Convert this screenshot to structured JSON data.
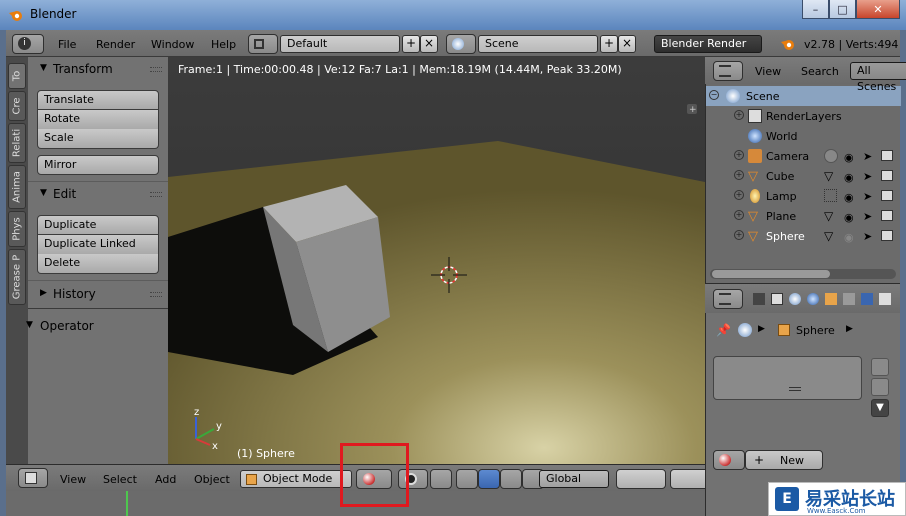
{
  "window": {
    "title": "Blender",
    "buttons": {
      "minimize": "–",
      "maximize": "□",
      "close": "✕"
    }
  },
  "info_header": {
    "menus": [
      "File",
      "Render",
      "Window",
      "Help"
    ],
    "screen_layout": "Default",
    "scene": "Scene",
    "render_engine": "Blender Render",
    "version_stats": "v2.78 | Verts:494"
  },
  "tool_tabs": [
    "To",
    "Cre",
    "Relati",
    "Anima",
    "Phys",
    "Grease P"
  ],
  "tool_shelf": {
    "transform": {
      "title": "Transform",
      "buttons": [
        "Translate",
        "Rotate",
        "Scale"
      ],
      "mirror": "Mirror"
    },
    "edit": {
      "title": "Edit",
      "buttons": [
        "Duplicate",
        "Duplicate Linked",
        "Delete"
      ]
    },
    "history": {
      "title": "History"
    },
    "operator": {
      "title": "Operator"
    }
  },
  "viewport": {
    "info": "Frame:1 | Time:00:00.48 | Ve:12 Fa:7 La:1 | Mem:18.19M (14.44M, Peak 33.20M)",
    "active_object": "(1) Sphere",
    "axis": {
      "x": "x",
      "y": "y",
      "z": "z"
    }
  },
  "view_header": {
    "menus": [
      "View",
      "Select",
      "Add",
      "Object"
    ],
    "mode": "Object Mode",
    "orientation": "Global"
  },
  "outliner": {
    "header": {
      "view": "View",
      "search": "Search",
      "filter": "All Scenes"
    },
    "items": [
      {
        "name": "Scene",
        "icon": "scene-icon",
        "indent": 0
      },
      {
        "name": "RenderLayers",
        "icon": "render-layers-icon",
        "indent": 1
      },
      {
        "name": "World",
        "icon": "world-icon",
        "indent": 1
      },
      {
        "name": "Camera",
        "icon": "camera-icon",
        "indent": 1
      },
      {
        "name": "Cube",
        "icon": "mesh-icon",
        "indent": 1
      },
      {
        "name": "Lamp",
        "icon": "lamp-icon",
        "indent": 1
      },
      {
        "name": "Plane",
        "icon": "mesh-icon",
        "indent": 1
      },
      {
        "name": "Sphere",
        "icon": "mesh-icon",
        "indent": 1
      }
    ]
  },
  "properties": {
    "breadcrumb_object": "Sphere",
    "new_button": "New"
  },
  "watermark": {
    "logo": "E",
    "text": "易采站长站",
    "sub": "Www.Easck.Com"
  },
  "colors": {
    "highlight": "#e0191f",
    "selected_row": "#8aa3c0"
  }
}
